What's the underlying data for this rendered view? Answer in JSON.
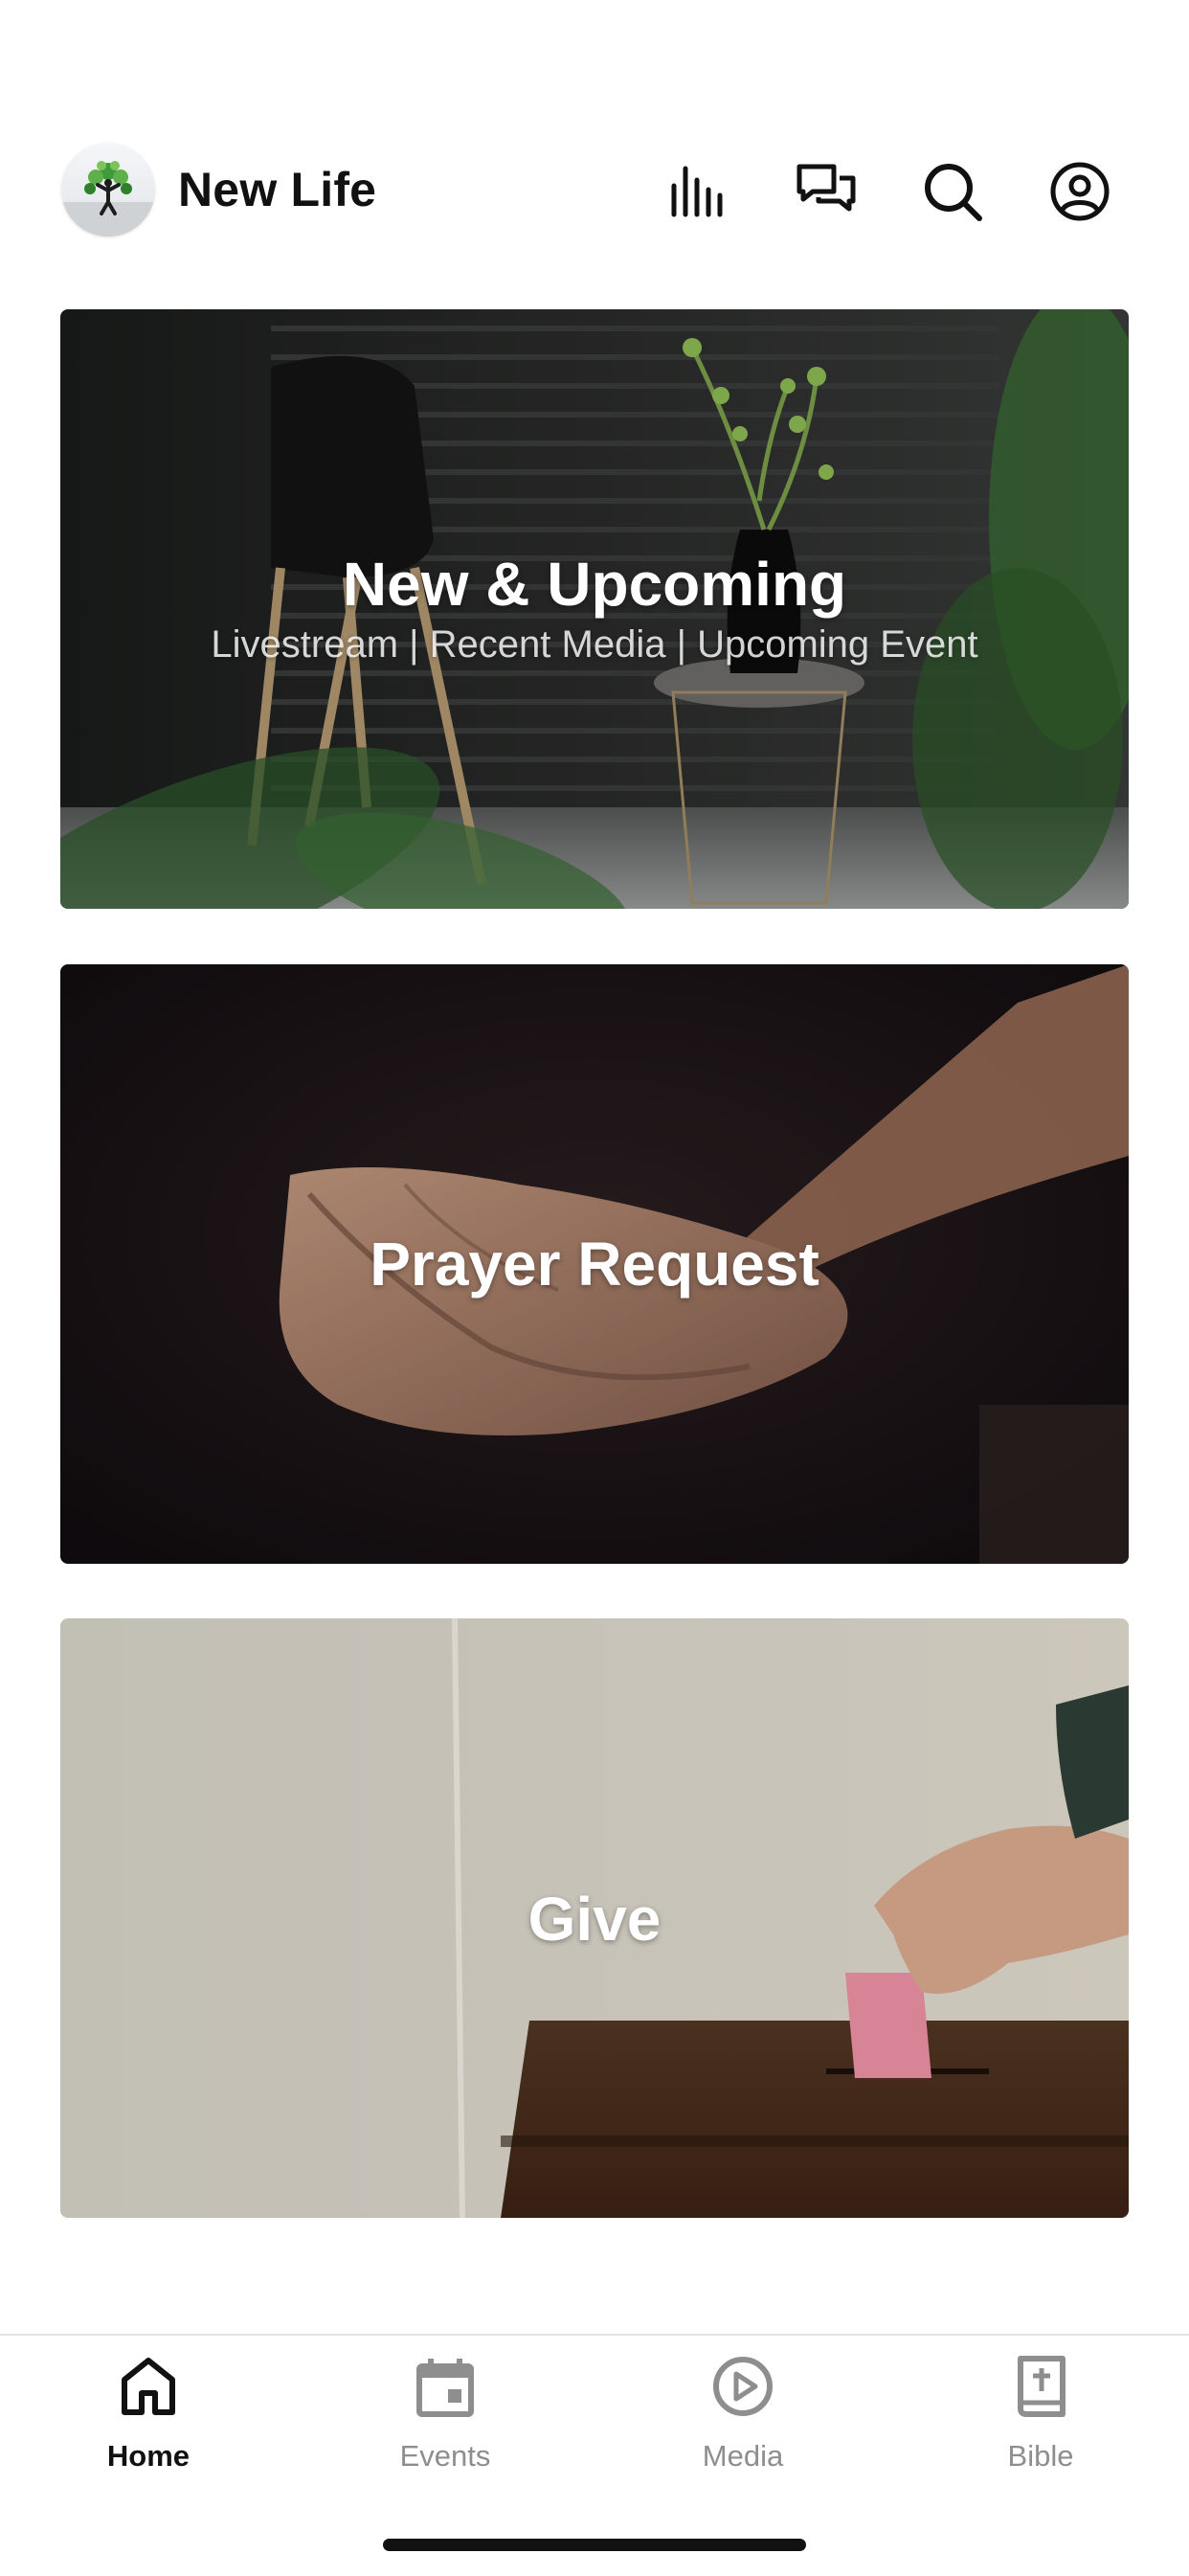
{
  "header": {
    "title": "New Life",
    "icons": [
      "equalizer-icon",
      "chat-bubbles-icon",
      "search-icon",
      "profile-icon"
    ]
  },
  "cards": [
    {
      "title": "New & Upcoming",
      "subtitle": "Livestream | Recent Media | Upcoming Event"
    },
    {
      "title": "Prayer Request"
    },
    {
      "title": "Give"
    }
  ],
  "tabs": [
    {
      "label": "Home",
      "icon": "home-icon",
      "active": true
    },
    {
      "label": "Events",
      "icon": "calendar-icon",
      "active": false
    },
    {
      "label": "Media",
      "icon": "play-circle-icon",
      "active": false
    },
    {
      "label": "Bible",
      "icon": "bible-icon",
      "active": false
    }
  ],
  "colors": {
    "active_tab": "#111111",
    "inactive_tab": "#8e8e8e",
    "card_text": "#ffffff"
  }
}
